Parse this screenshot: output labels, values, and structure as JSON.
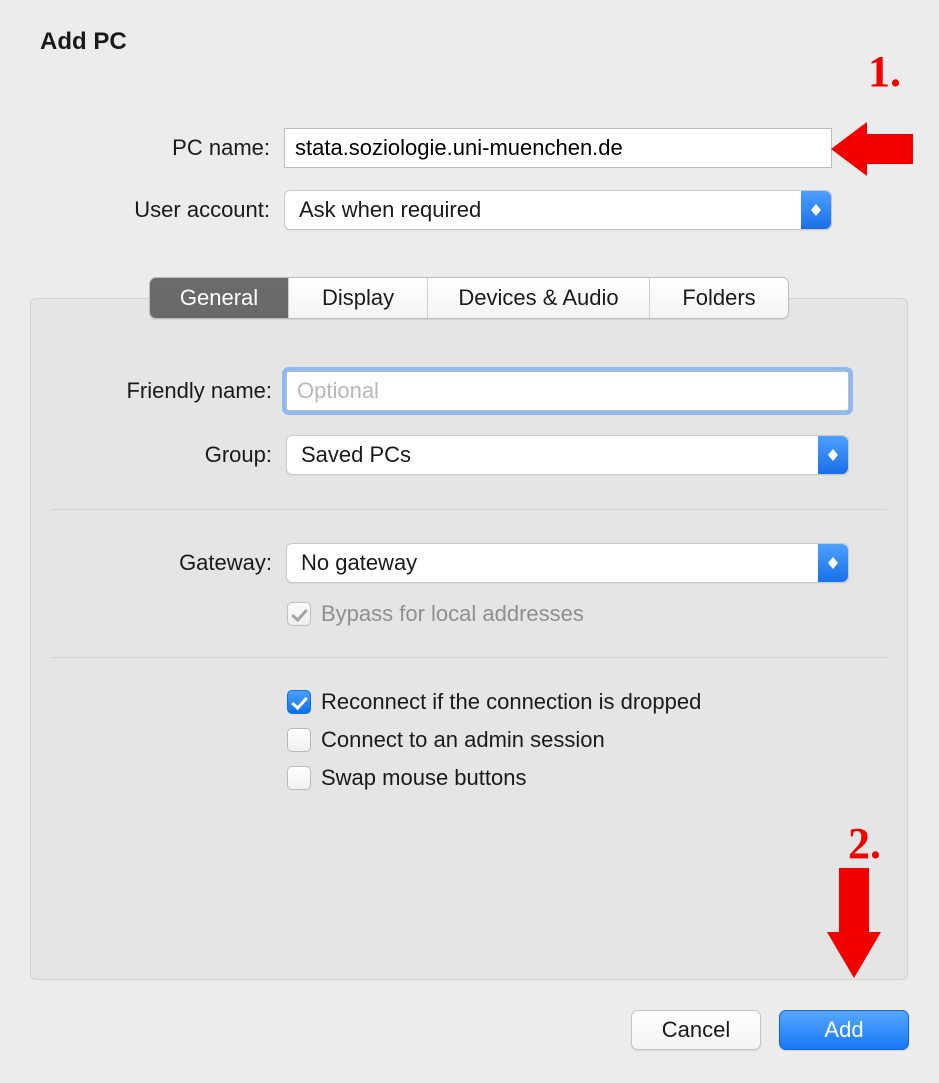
{
  "title": "Add PC",
  "labels": {
    "pc_name": "PC name:",
    "user_account": "User account:",
    "friendly_name": "Friendly name:",
    "group": "Group:",
    "gateway": "Gateway:"
  },
  "fields": {
    "pc_name_value": "stata.soziologie.uni-muenchen.de",
    "user_account_value": "Ask when required",
    "friendly_name_value": "",
    "friendly_name_placeholder": "Optional",
    "group_value": "Saved PCs",
    "gateway_value": "No gateway"
  },
  "tabs": {
    "general": "General",
    "display": "Display",
    "devices": "Devices & Audio",
    "folders": "Folders"
  },
  "checkboxes": {
    "bypass": "Bypass for local addresses",
    "reconnect": "Reconnect if the connection is dropped",
    "admin": "Connect to an admin session",
    "swap": "Swap mouse buttons"
  },
  "buttons": {
    "cancel": "Cancel",
    "add": "Add"
  },
  "annotations": {
    "one": "1.",
    "two": "2."
  }
}
